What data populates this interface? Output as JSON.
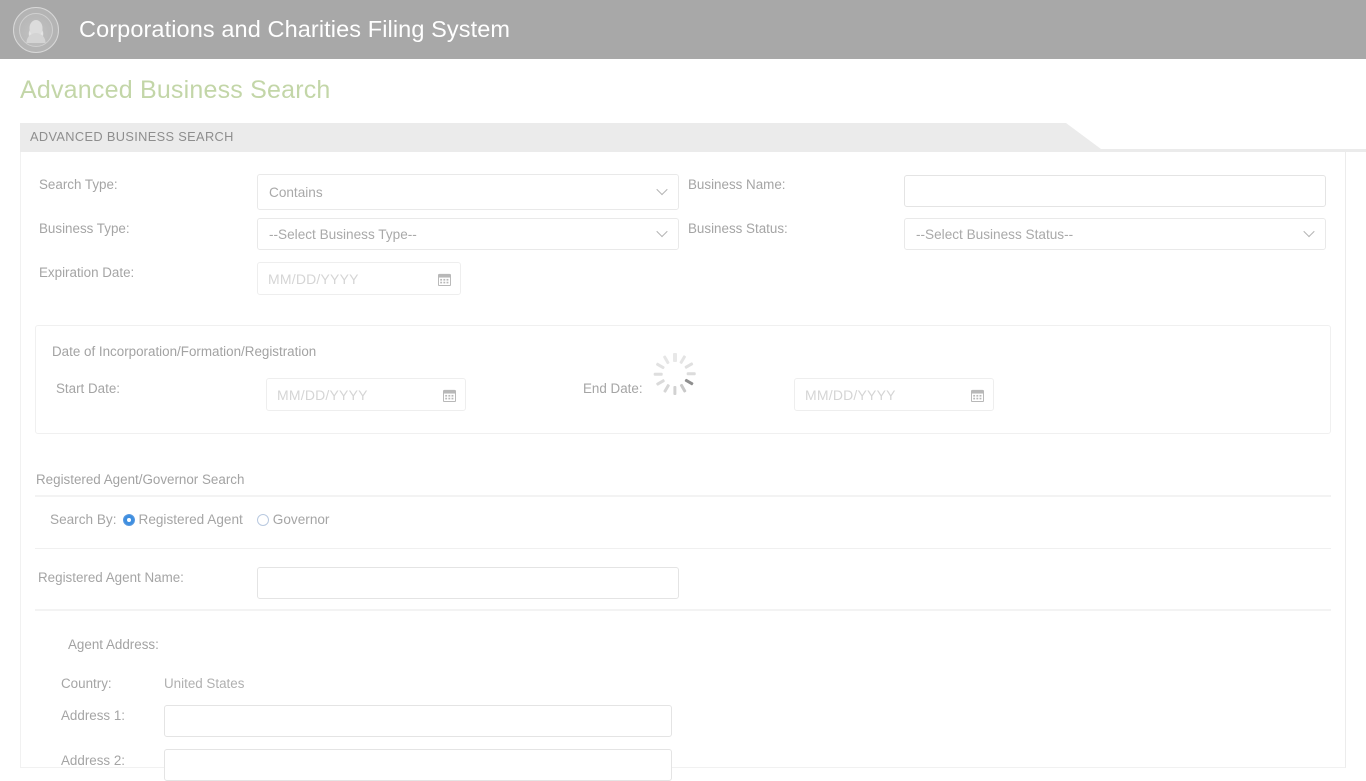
{
  "header": {
    "app_title": "Corporations and Charities Filing System",
    "seal_name": "washington-state-seal",
    "bg_color": "#a8a8a8"
  },
  "page": {
    "title": "Advanced Business Search",
    "title_color": "#c3d6a8"
  },
  "tab": {
    "label": "ADVANCED BUSINESS SEARCH",
    "bg_color": "#ebebeb"
  },
  "form": {
    "search_type": {
      "label": "Search Type:",
      "value": "Contains"
    },
    "business_name": {
      "label": "Business Name:",
      "value": "",
      "placeholder": ""
    },
    "business_type": {
      "label": "Business Type:",
      "value": "--Select Business Type--"
    },
    "business_status": {
      "label": "Business Status:",
      "value": "--Select Business Status--"
    },
    "expiration_date": {
      "label": "Expiration Date:",
      "value": "",
      "placeholder": "MM/DD/YYYY"
    }
  },
  "incorporation": {
    "title": "Date of Incorporation/Formation/Registration",
    "start_date": {
      "label": "Start Date:",
      "value": "",
      "placeholder": "MM/DD/YYYY"
    },
    "end_date": {
      "label": "End Date:",
      "value": "",
      "placeholder": "MM/DD/YYYY"
    },
    "spinner_name": "loading-spinner"
  },
  "agent_search": {
    "section_title": "Registered Agent/Governor Search",
    "search_by_label": "Search By:",
    "options": [
      {
        "label": "Registered Agent",
        "selected": true
      },
      {
        "label": "Governor",
        "selected": false
      }
    ],
    "selected_color": "#3f8fe0",
    "agent_name": {
      "label": "Registered Agent Name:",
      "value": "",
      "placeholder": ""
    }
  },
  "agent_address": {
    "title": "Agent Address:",
    "country": {
      "label": "Country:",
      "value": "United States"
    },
    "address1": {
      "label": "Address 1:",
      "value": "",
      "placeholder": ""
    },
    "address2": {
      "label": "Address 2:",
      "value": "",
      "placeholder": ""
    }
  }
}
